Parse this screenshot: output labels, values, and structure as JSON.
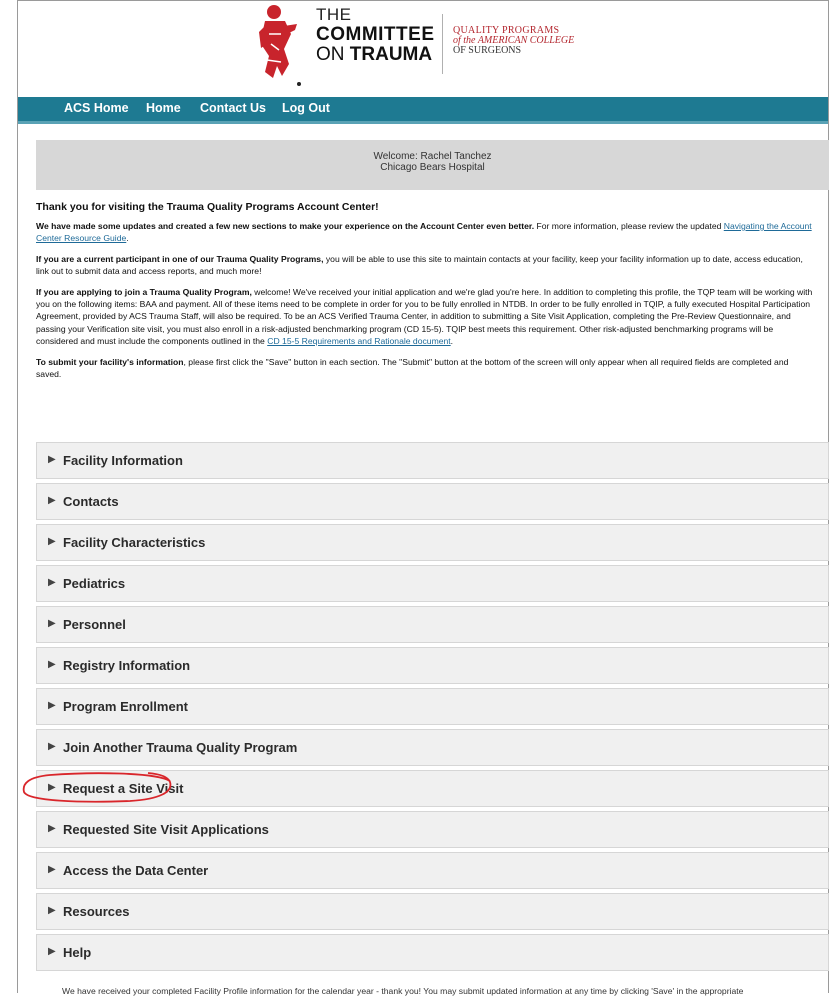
{
  "header": {
    "logo_the": "THE",
    "logo_committee": "COMMITTEE",
    "logo_on": "ON",
    "logo_trauma": "TRAUMA",
    "qp_line1": "QUALITY PROGRAMS",
    "qp_line2": "of the AMERICAN COLLEGE",
    "qp_line3": "OF SURGEONS",
    "brand_color": "#b3262e"
  },
  "nav": {
    "color": "#1e7a92",
    "items": [
      {
        "label": "ACS Home"
      },
      {
        "label": "Home"
      },
      {
        "label": "Contact Us"
      },
      {
        "label": "Log Out"
      }
    ]
  },
  "welcome": {
    "line1": "Welcome: Rachel Tanchez",
    "line2": "Chicago Bears Hospital"
  },
  "intro": {
    "heading": "Thank you for visiting the Trauma Quality Programs Account Center!",
    "p1_bold": "We have made some updates and created a few new sections to make your experience on the Account Center even better.",
    "p1_text": "  For more information, please review the updated ",
    "p1_link": "Navigating the Account Center Resource Guide",
    "p1_end": ".",
    "p2_bold": "If you are a current participant in one of our Trauma Quality Programs,",
    "p2_text": " you will be able to use this site to maintain contacts at your facility, keep your facility information up to date, access education, link out to submit data and access reports, and much more!",
    "p3_bold": "If you are applying to join a Trauma Quality Program,",
    "p3_text": " welcome!  We've received your initial application and we're glad you're here.  In addition to completing this profile, the TQP team will be working with you on the following items: BAA and payment.  All of these items need to be complete in order for you to be fully enrolled in NTDB.   In order to be fully enrolled in TQIP, a fully executed Hospital Participation Agreement, provided by ACS Trauma Staff, will also be required.  To be an ACS Verified Trauma Center, in addition to submitting a Site Visit Application, completing the Pre-Review Questionnaire, and passing your Verification site visit, you must also enroll in a risk-adjusted benchmarking program (CD 15-5).  TQIP best meets this requirement.  Other risk-adjusted benchmarking programs will be considered and must include the components outlined in the ",
    "p3_link": "CD 15-5 Requirements and Rationale document",
    "p3_end": ".",
    "p4_bold": "To submit your facility's information",
    "p4_text": ", please first click the \"Save\" button in each section.  The \"Submit\" button at the bottom of the screen will only appear when all required fields are completed and saved."
  },
  "sections": [
    {
      "label": "Facility Information"
    },
    {
      "label": "Contacts"
    },
    {
      "label": "Facility Characteristics"
    },
    {
      "label": "Pediatrics"
    },
    {
      "label": "Personnel"
    },
    {
      "label": "Registry Information"
    },
    {
      "label": "Program Enrollment"
    },
    {
      "label": "Join Another Trauma Quality Program"
    },
    {
      "label": "Request a Site Visit"
    },
    {
      "label": "Requested Site Visit Applications"
    },
    {
      "label": "Access the Data Center"
    },
    {
      "label": "Resources"
    },
    {
      "label": "Help"
    }
  ],
  "arrow_glyph": "▶",
  "footer": {
    "text": "We have received your completed Facility Profile information for the calendar year - thank you!  You may submit updated information at any time by clicking 'Save' in the appropriate"
  },
  "annotation_color": "#d9262b"
}
